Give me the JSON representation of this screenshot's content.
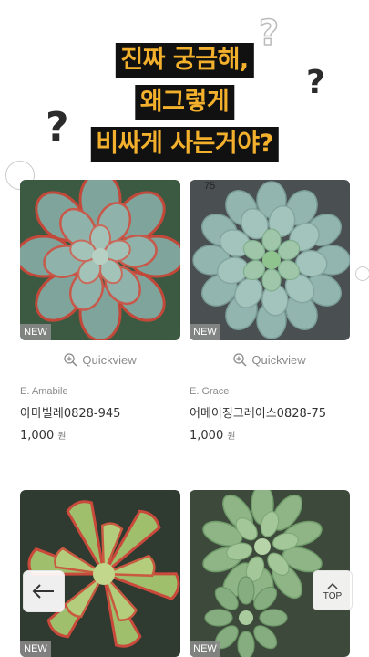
{
  "banner": {
    "line1": "진짜 궁금해,",
    "line2": "왜그렇게",
    "line3": "비싸게 사는거야?"
  },
  "products": [
    {
      "badge": "NEW",
      "quickview": "Quickview",
      "english_name": "E. Amabile",
      "name": "아마빌레0828-945",
      "price": "1,000",
      "currency": "원"
    },
    {
      "badge": "NEW",
      "quickview": "Quickview",
      "english_name": "E. Grace",
      "name": "어메이징그레이스0828-75",
      "price": "1,000",
      "currency": "원",
      "pot_label": "75"
    },
    {
      "badge": "NEW"
    },
    {
      "badge": "NEW"
    }
  ],
  "controls": {
    "back_icon": "arrow-left-icon",
    "top_label": "TOP"
  },
  "colors": {
    "banner_bg": "#111111",
    "banner_text": "#f3b02c"
  }
}
